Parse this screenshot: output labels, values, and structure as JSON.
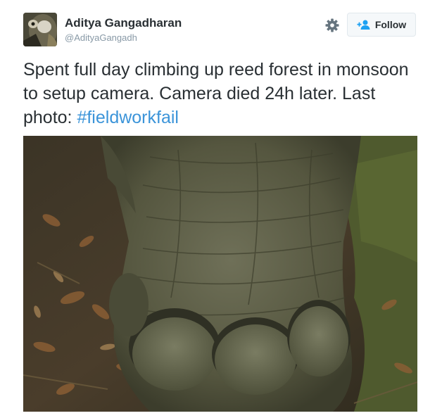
{
  "user": {
    "name": "Aditya Gangadharan",
    "handle": "@AdityaGangadh"
  },
  "actions": {
    "follow_label": "Follow",
    "settings_icon": "gear-icon",
    "follow_icon": "follow-person-plus-icon"
  },
  "tweet": {
    "text": "Spent full day climbing up reed forest in monsoon to setup camera. Camera died 24h later. Last photo: ",
    "hashtag": "#fieldworkfail"
  },
  "colors": {
    "hashtag": "#3b94d9",
    "name": "#292f33",
    "handle": "#8899a6",
    "follow_accent": "#1da1f2"
  }
}
